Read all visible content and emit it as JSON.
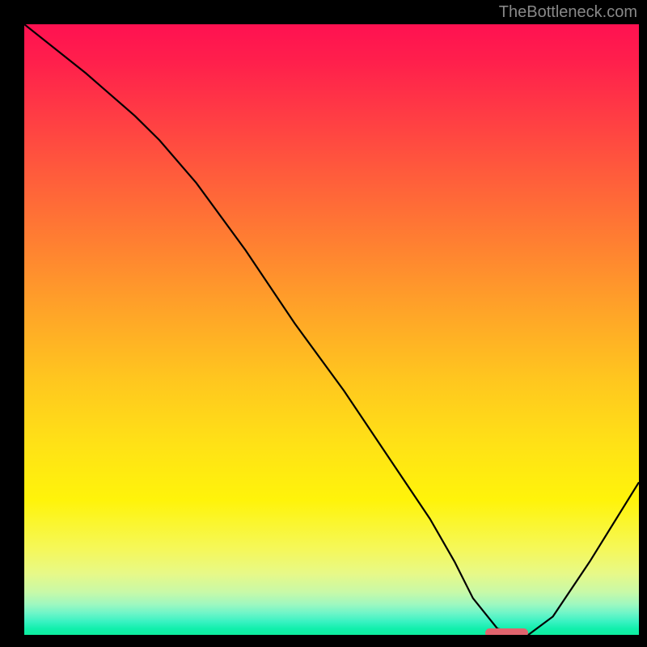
{
  "watermark": "TheBottleneck.com",
  "chart_data": {
    "type": "line",
    "title": "",
    "xlabel": "",
    "ylabel": "",
    "xlim": [
      0,
      100
    ],
    "ylim": [
      0,
      100
    ],
    "background_gradient": {
      "top_color": "#ff1151",
      "bottom_color": "#0dee9e",
      "meaning": "red=high bottleneck, green=low bottleneck"
    },
    "series": [
      {
        "name": "bottleneck-curve",
        "color": "#000000",
        "x": [
          0,
          10,
          18,
          22,
          28,
          36,
          44,
          52,
          60,
          66,
          70,
          73,
          77,
          82,
          86,
          92,
          100
        ],
        "y": [
          100,
          92,
          85,
          81,
          74,
          63,
          51,
          40,
          28,
          19,
          12,
          6,
          1,
          0,
          3,
          12,
          25
        ]
      }
    ],
    "marker": {
      "name": "optimal-range",
      "color": "#e0646e",
      "x_start": 75,
      "x_end": 82,
      "y": 0
    }
  }
}
